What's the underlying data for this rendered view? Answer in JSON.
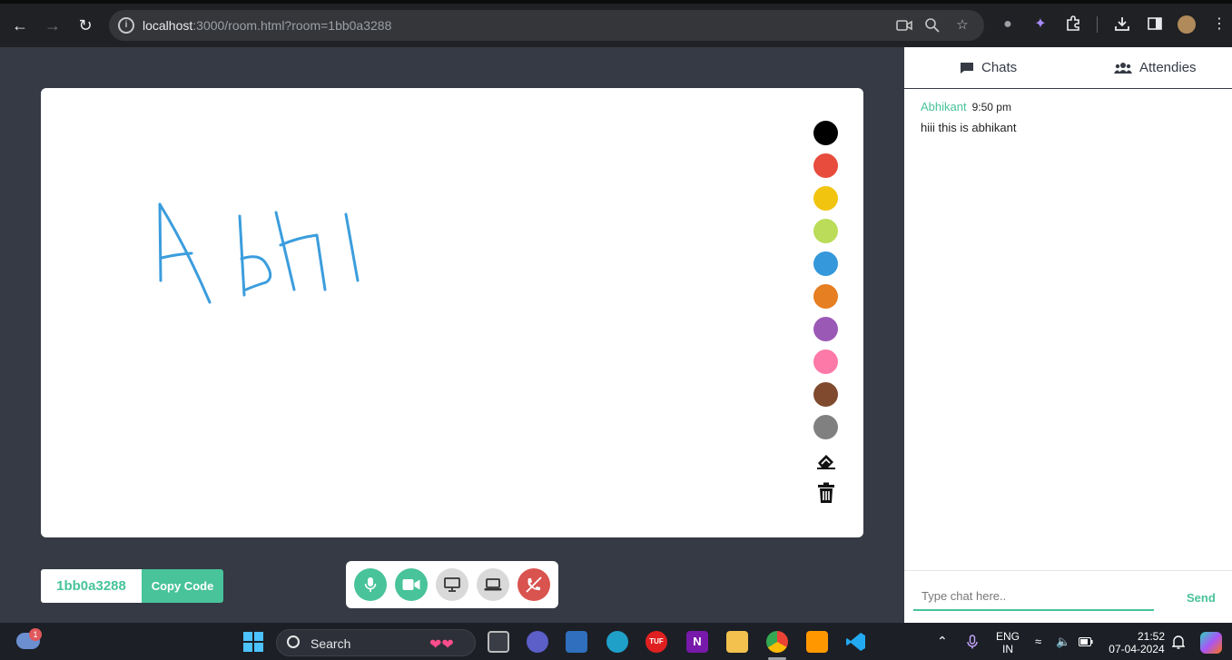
{
  "browser": {
    "url_host": "localhost",
    "url_rest": ":3000/room.html?room=1bb0a3288"
  },
  "whiteboard": {
    "palette": [
      "#000000",
      "#e74c3c",
      "#f1c40f",
      "#badc58",
      "#3498db",
      "#e67e22",
      "#9b59b6",
      "#fd79a8",
      "#7f4a2e",
      "#808080"
    ],
    "stroke_color": "#3b9ddd",
    "tools": [
      "eraser-icon",
      "trash-icon"
    ]
  },
  "room": {
    "code": "1bb0a3288",
    "copy_label": "Copy Code"
  },
  "controls": [
    {
      "name": "mic-button",
      "icon": "mic-icon",
      "color": "#48c39a"
    },
    {
      "name": "camera-button",
      "icon": "video-icon",
      "color": "#48c39a"
    },
    {
      "name": "whiteboard-button",
      "icon": "monitor-icon",
      "color": "#d9d9d9"
    },
    {
      "name": "screen-share-button",
      "icon": "laptop-icon",
      "color": "#d9d9d9"
    },
    {
      "name": "end-call-button",
      "icon": "phone-slash-icon",
      "color": "#d9534f"
    }
  ],
  "side": {
    "tabs": {
      "chats": "Chats",
      "attendees": "Attendies"
    },
    "messages": [
      {
        "sender": "Abhikant",
        "time": "9:50 pm",
        "text": "hiii this is abhikant"
      }
    ],
    "input_placeholder": "Type chat here..",
    "send_label": "Send"
  },
  "taskbar": {
    "weather_badge": "1",
    "search_label": "Search",
    "lang_top": "ENG",
    "lang_bottom": "IN",
    "clock_time": "21:52",
    "clock_date": "07-04-2024"
  }
}
